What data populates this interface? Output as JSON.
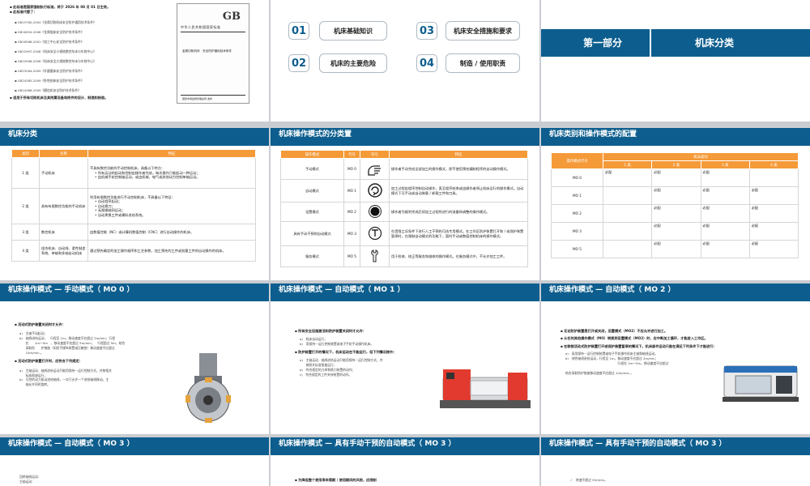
{
  "s1": {
    "bullets": [
      "此标准是国家强制执行标准，将于 2026 年 08 月 01 日生效。",
      "此标准代替了：",
      "GB15760-2004《金属切削机床安全防护通用技术条件》",
      "GB16454-2008《金属锯床安全防护技术条件》",
      "GB18568-2001《加工中心安全防护技术条件》",
      "GB22997-2008《机床安全小规格数控车床与车削中心》",
      "GB22998-2008《机床安全大规格数控车床与车削中心》",
      "GB23284-2009《外圆磨床安全防护技术条件》",
      "GB24385-2009《卧铣刨床安全防护技术条件》",
      "GB24386-2009《磨齿机安全防护技术条件》",
      "适用于所有切削机床及其附属设备和附件的设计、制造和检验。"
    ],
    "doc": {
      "badge": "GB",
      "org": "中华人民共和国国家标准",
      "title": "金属切削机床　安全防护通用技术条件",
      "foot": "国家市场监督管理总局 发布"
    }
  },
  "s2": {
    "items": [
      {
        "num": "01",
        "label": "机床基础知识"
      },
      {
        "num": "03",
        "label": "机床安全措施和要求"
      },
      {
        "num": "02",
        "label": "机床的主要危险"
      },
      {
        "num": "04",
        "label": "制造 / 使用职责"
      }
    ]
  },
  "s3": {
    "part": "第一部分",
    "title": "机床分类"
  },
  "s4": {
    "title": "机床分类",
    "headers": [
      "类别",
      "名称",
      "特征"
    ],
    "rows": [
      {
        "c": "1 类",
        "n": "手动机床",
        "f": [
          "不具有数控功能的手动控制机床，具备以下特点：",
          "所有运动的起动和控制由操作者完成，每次操作只能起动一种运动；",
          "由机械手轮控制轴运动，或由机械、电气或其他动力控制单轴运动。"
        ]
      },
      {
        "c": "2 类",
        "n": "具有有限数控功能的手动机床",
        "f": [
          "利用有限数控功能进行手动控制机床，不具备以下特征：",
          "自动程序起动；",
          "自动换刀；",
          "无限操轴同运动；",
          "自动更换工件或横料进给系统。"
        ]
      },
      {
        "c": "3 类",
        "n": "数控机床",
        "f": [
          "由数值控制（NC）或计算机数值控制（CNC）进行自动操作的机床。"
        ]
      },
      {
        "c": "4 类",
        "n": "组合机床、自动线、柔性制造系统、单轴和多轴自动机床",
        "f": [
          "通过预先确定的加工操作顺序和工艺参数，加工预先的工件或批量工件的自动操作的机床。"
        ]
      }
    ]
  },
  "s5": {
    "title": "机床操作模式的分类置",
    "headers": [
      "操作模式",
      "代号",
      "符号",
      "特征"
    ],
    "rows": [
      {
        "m": "手动模式",
        "c": "MO 0",
        "f": "操作者手动完成全部加工的操作模式，即不使用预先编制程序的自动操作模式。"
      },
      {
        "m": "自动模式",
        "c": "MO 1",
        "f": "加工过程由程序控制自动操作，直至程序结束或由操作者停止机床运行的操作模式。自动模式下可手动或自动装载 / 卸载工件和刀具。"
      },
      {
        "m": "设置模式",
        "c": "MO 2",
        "f": "操作者为顺利完成后续加工过程所进行的准备和调整的操作模式。"
      },
      {
        "m": "具有手动干预的自动模式",
        "c": "MO 3",
        "f": "在受限工况条件下进行人工干预的可选专用模式。在工作区防护装置打开和 / 或保护装置暂停时，在限制自动模式的功能下，暂时手动或数值控制机床的操作模式。"
      },
      {
        "m": "服务模式",
        "c": "MO 5",
        "f": "用于检修、校正等服务和维修的操作模式。在服务模式中，不允许加工工件。"
      }
    ]
  },
  "s6": {
    "title": "机床类别和操作模式的配置",
    "header_main": "操作模式代号",
    "header_group": "机床类别",
    "cols": [
      "1 类",
      "2 类",
      "3 类",
      "4 类"
    ],
    "rows": [
      {
        "m": "MO 0",
        "v": [
          "必配",
          "必配",
          "必配",
          ""
        ]
      },
      {
        "m": "MO 1",
        "v": [
          "",
          "必配",
          "必配",
          "必配"
        ]
      },
      {
        "m": "MO 2",
        "v": [
          "",
          "必配",
          "必配",
          "必配"
        ]
      },
      {
        "m": "MO 3",
        "v": [
          "",
          "必配",
          "必配",
          "必配"
        ]
      },
      {
        "m": "MO 5",
        "v": [
          "",
          "必配",
          "必配",
          "必配"
        ]
      }
    ]
  },
  "s7": {
    "title": "机床操作模式 — 手动模式（ MO 0 ）",
    "lines": [
      "活动式防护装置关闭时才允许：",
      "a)　主轴手动起动；",
      "b)　轴线进给运动，　行程至 1m，移动速度不应超过 2m/min；行程",
      "　　在　　1m～5m　，移动速度不应超过 5m/min；　行程超过 5m，结合",
      "　　采取防　　护措施（如双手操纵装置或压敏垫）移动速度不应超过",
      "　　10m/min 。",
      "活动式防护装置打开时，应符合下列规定：",
      "a)　主轴运动、轴线进给运动只能用保持－运行控制方式，并按相关",
      "　　标准限速运行；",
      "b)　可控的动力驱动进给轴线，一次只允许一个进给轴线移动。主",
      "　　轴允许同时旋转。"
    ]
  },
  "s8": {
    "title": "机床操作模式 — 自动模式（ MO 1 ）",
    "lines": [
      "所有安全设施激活和防护装置关闭时才允许：",
      "a)　机床自动运行；",
      "b)　用保持－运行控制装置或电子手轮手动操作机床。",
      "防护装置打开的情况下，机床运动在不能运行，但下列情况除外：",
      "a)　主轴运动、轴线进给运动只能用保持－运行控制方式，并",
      "　　按照关标准限速运行；",
      "b)　符合规定的刀库和换刀装置的动作；",
      "c)　符合规定的工件夹持装置的动作。"
    ]
  },
  "s9": {
    "title": "机床操作模式 — 自动模式（ MO 2 ）",
    "lines": [
      "无论防护装置是打开或关闭，设置模式（MO2）不应允许进行加工。",
      "从任何其他操作模式（MO）转换到设置模式（MO2）时，应中断加工循环，才能进入工作区。",
      "在联锁活动式防护装置打开或保护装置暂停的情况下，机床部件运动只能在满足下列条件下才能进行：",
      "a)　采用保持－运行控制装置或电子手轮操作机床主轴和轴线运动。",
      "b)　线性轴线进给运动，行程至 1m，移动速度不应超过 2m/min；",
      "　　　　　　　　　　　　　　　　　行程在 1m～5m，移动速度不应超过",
      "结合采取防护措施移动速度不应超过 10m/min 。"
    ]
  },
  "s10": {
    "title": "机床操作模式 — 自动模式（ MO 3 ）",
    "lines": [
      "回转轴线运动：",
      "主轴运动："
    ]
  },
  "s11": {
    "title": "机床操作模式 — 具有手动干预的自动模式（ MO 3 ）",
    "lines": [
      "为降低整个使用寿命周期 / 使用期间的风险，应限制"
    ]
  },
  "s12": {
    "title": "机床操作模式 — 具有手动干预的自动模式（ MO 3 ）",
    "lines": [
      "转速不超过 50r/min。"
    ]
  }
}
